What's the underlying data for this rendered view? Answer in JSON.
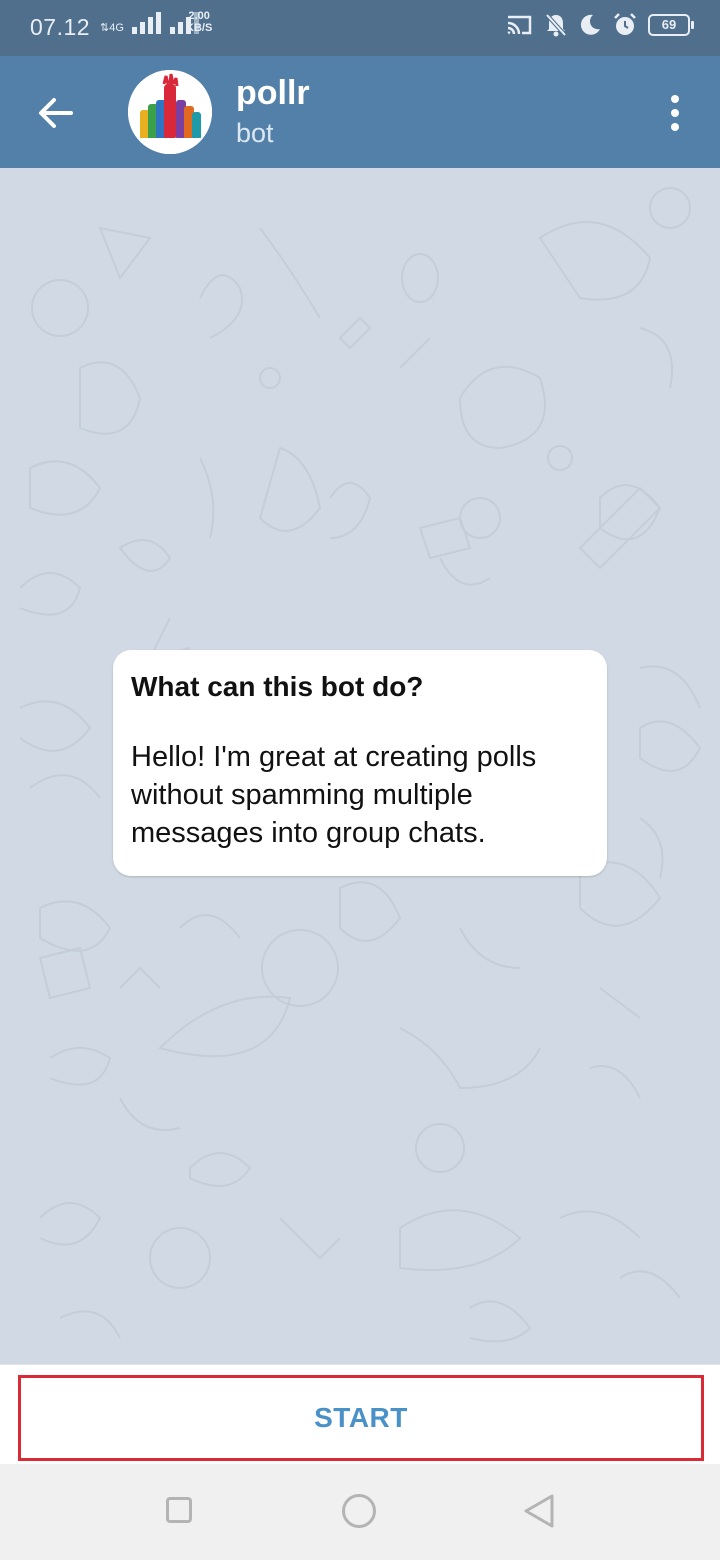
{
  "status_bar": {
    "time": "07.12",
    "network_type": "4G",
    "data_speed_value": "2.00",
    "data_speed_unit": "KB/S",
    "battery_level": "69"
  },
  "header": {
    "title": "pollr",
    "subtitle": "bot"
  },
  "info_card": {
    "title": "What can this bot do?",
    "body": "Hello! I'm great at creating polls without spamming multiple messages into group chats."
  },
  "action": {
    "start_label": "START"
  },
  "colors": {
    "header_bg": "#5280a8",
    "status_bar_bg": "#4f6f8c",
    "chat_bg": "#d1dae4",
    "start_text": "#4a91c8",
    "highlight_border": "#d92a36"
  }
}
